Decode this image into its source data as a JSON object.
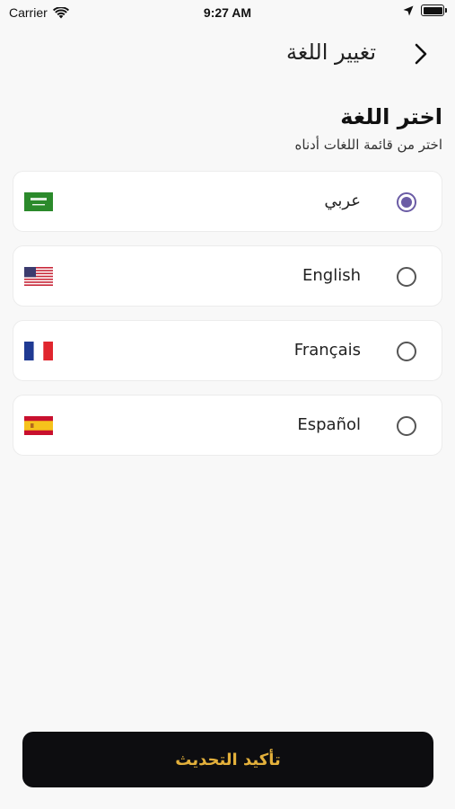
{
  "status_bar": {
    "carrier": "Carrier",
    "time": "9:27 AM"
  },
  "header": {
    "title": "تغيير اللغة",
    "back_icon": "chevron-right-icon"
  },
  "section": {
    "title": "اختر اللغة",
    "subtitle": "اختر من قائمة اللغات أدناه"
  },
  "languages": [
    {
      "label": "عربي",
      "flag": "saudi-arabia-flag",
      "selected": true
    },
    {
      "label": "English",
      "flag": "usa-flag",
      "selected": false
    },
    {
      "label": "Français",
      "flag": "france-flag",
      "selected": false
    },
    {
      "label": "Español",
      "flag": "spain-flag",
      "selected": false
    }
  ],
  "confirm_button": {
    "label": "تأكيد التحديث"
  },
  "colors": {
    "accent": "#6b5ca5",
    "button_bg": "#0d0d10",
    "button_text": "#e3b03b"
  }
}
